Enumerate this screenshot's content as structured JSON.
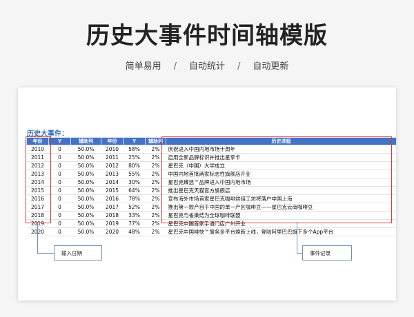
{
  "header": {
    "title": "历史大事件时间轴模版",
    "features": [
      "简单易用",
      "自动统计",
      "自动更新"
    ],
    "separator": "/"
  },
  "sheet": {
    "title": "历史大事件：",
    "columns": [
      "年份",
      "Y",
      "辅助列",
      "年份",
      "Y",
      "辅助列",
      "历史进程"
    ],
    "rows": [
      [
        "2010",
        "0",
        "50.0%",
        "2010",
        "58%",
        "2%",
        "庆祝进入中国内地市场十周年"
      ],
      [
        "2011",
        "0",
        "50.0%",
        "2011",
        "25%",
        "2%",
        "启用全新品牌标识并推出星享卡"
      ],
      [
        "2012",
        "0",
        "50.0%",
        "2012",
        "80%",
        "2%",
        "星巴克（中国）大学成立"
      ],
      [
        "2013",
        "0",
        "50.0%",
        "2013",
        "55%",
        "2%",
        "中国内地首批两家标志性旗舰店开业"
      ],
      [
        "2014",
        "0",
        "50.0%",
        "2014",
        "30%",
        "2%",
        "星巴克臻选™品牌进入中国内地市场"
      ],
      [
        "2015",
        "0",
        "50.0%",
        "2015",
        "64%",
        "2%",
        "推出星巴克天猫官方旗舰店"
      ],
      [
        "2016",
        "0",
        "50.0%",
        "2016",
        "78%",
        "2%",
        "宣布海外市场首家星巴克咖啡烘焙工坊将落户中国上海"
      ],
      [
        "2017",
        "0",
        "50.0%",
        "2017",
        "52%",
        "2%",
        "推出第一款产自于中国的单一产区咖啡豆——星巴克云南咖啡豆"
      ],
      [
        "2018",
        "0",
        "50.0%",
        "2018",
        "33%",
        "2%",
        "星巴克与雀巢结为全球咖啡联盟"
      ],
      [
        "2019",
        "0",
        "50.0%",
        "2019",
        "77%",
        "2%",
        "星巴克中国首家手语门店广州开业"
      ],
      [
        "2020",
        "0",
        "50.0%",
        "2020",
        "48%",
        "2%",
        "星巴克中国啡快™服务多平台焕新上线，登陆阿里巴巴旗下多个App平台"
      ]
    ]
  },
  "callouts": {
    "date_input": "输入日期",
    "event_record": "事件记录"
  },
  "colors": {
    "header_blue": "#4472c4",
    "highlight_red": "#d23a3a",
    "callout_blue": "#6d8fb8"
  }
}
